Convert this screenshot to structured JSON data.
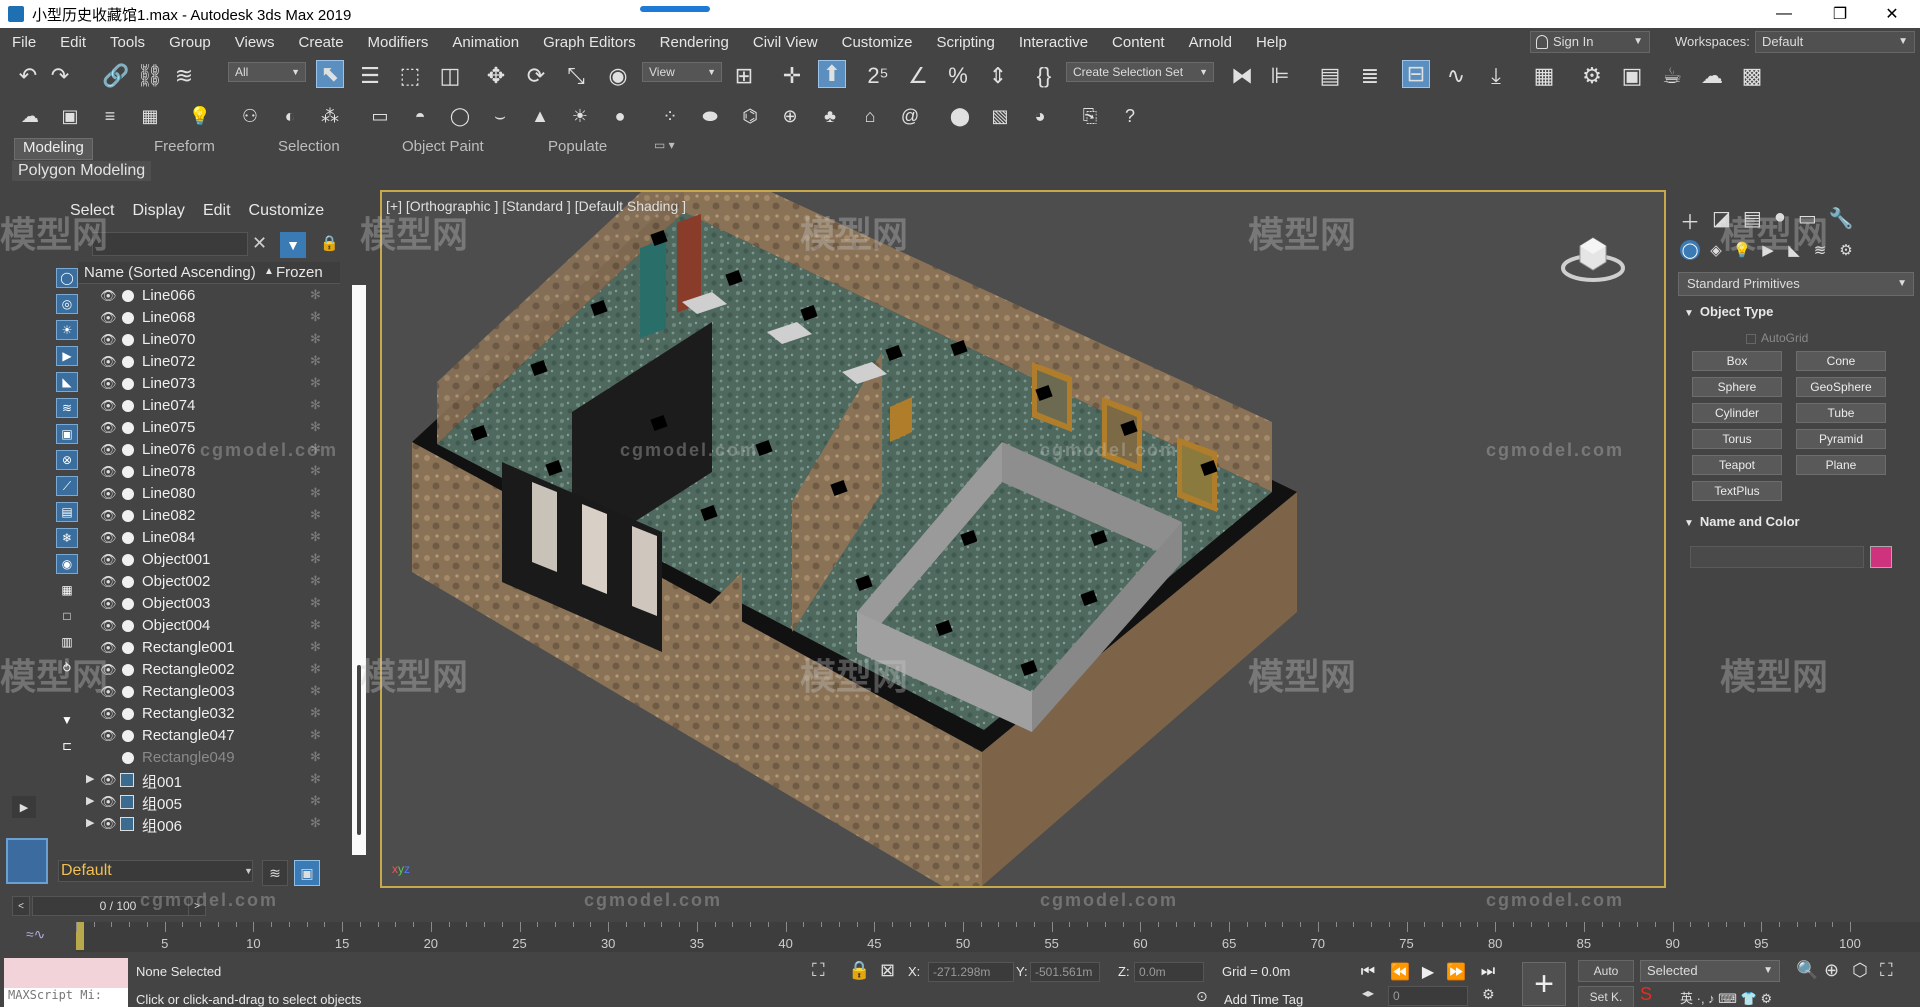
{
  "window": {
    "title": "小型历史收藏馆1.max - Autodesk 3ds Max 2019",
    "controls": [
      "—",
      "❐",
      "✕"
    ]
  },
  "menu": [
    "File",
    "Edit",
    "Tools",
    "Group",
    "Views",
    "Create",
    "Modifiers",
    "Animation",
    "Graph Editors",
    "Rendering",
    "Civil View",
    "Customize",
    "Scripting",
    "Interactive",
    "Content",
    "Arnold",
    "Help"
  ],
  "account": {
    "signin_label": "Sign In",
    "workspaces_label": "Workspaces:",
    "workspace_value": "Default"
  },
  "toolbar": {
    "filter_value": "All",
    "refcoord_value": "View",
    "selection_set_placeholder": "Create Selection Set"
  },
  "ribbon": {
    "tabs": [
      "Modeling",
      "Freeform",
      "Selection",
      "Object Paint",
      "Populate"
    ],
    "active_tab": "Modeling",
    "subpanel": "Polygon Modeling"
  },
  "explorer": {
    "tabs": [
      "Select",
      "Display",
      "Edit",
      "Customize"
    ],
    "col_name": "Name (Sorted Ascending)",
    "col_frozen": "Frozen",
    "rows": [
      {
        "name": "Line066",
        "type": "obj"
      },
      {
        "name": "Line068",
        "type": "obj"
      },
      {
        "name": "Line070",
        "type": "obj"
      },
      {
        "name": "Line072",
        "type": "obj"
      },
      {
        "name": "Line073",
        "type": "obj"
      },
      {
        "name": "Line074",
        "type": "obj"
      },
      {
        "name": "Line075",
        "type": "obj"
      },
      {
        "name": "Line076",
        "type": "obj"
      },
      {
        "name": "Line078",
        "type": "obj"
      },
      {
        "name": "Line080",
        "type": "obj"
      },
      {
        "name": "Line082",
        "type": "obj"
      },
      {
        "name": "Line084",
        "type": "obj"
      },
      {
        "name": "Object001",
        "type": "obj"
      },
      {
        "name": "Object002",
        "type": "obj"
      },
      {
        "name": "Object003",
        "type": "obj"
      },
      {
        "name": "Object004",
        "type": "obj"
      },
      {
        "name": "Rectangle001",
        "type": "obj"
      },
      {
        "name": "Rectangle002",
        "type": "obj"
      },
      {
        "name": "Rectangle003",
        "type": "obj"
      },
      {
        "name": "Rectangle032",
        "type": "obj"
      },
      {
        "name": "Rectangle047",
        "type": "obj"
      },
      {
        "name": "Rectangle049",
        "type": "dim"
      },
      {
        "name": "组001",
        "type": "grp"
      },
      {
        "name": "组005",
        "type": "grp"
      },
      {
        "name": "组006",
        "type": "grp"
      }
    ],
    "layer_value": "Default"
  },
  "viewport": {
    "label": "[+] [Orthographic ] [Standard ] [Default Shading ]"
  },
  "command_panel": {
    "category": "Standard Primitives",
    "object_type_header": "Object Type",
    "autogrid_label": "AutoGrid",
    "primitives": [
      "Box",
      "Cone",
      "Sphere",
      "GeoSphere",
      "Cylinder",
      "Tube",
      "Torus",
      "Pyramid",
      "Teapot",
      "Plane",
      "TextPlus"
    ],
    "name_color_header": "Name and Color",
    "color_hex": "#d0337e"
  },
  "timeline": {
    "frame_display": "0 / 100",
    "ticks": [
      "5",
      "10",
      "15",
      "20",
      "25",
      "30",
      "35",
      "40",
      "45",
      "50",
      "55",
      "60",
      "65",
      "70",
      "75",
      "80",
      "85",
      "90",
      "95",
      "100"
    ]
  },
  "status": {
    "maxscript_placeholder": "MAXScript Mi:",
    "selection_text": "None Selected",
    "prompt_text": "Click or click-and-drag to select objects",
    "x_label": "X:",
    "x_value": "-271.298m",
    "y_label": "Y:",
    "y_value": "-501.561m",
    "z_label": "Z:",
    "z_value": "0.0m",
    "grid_text": "Grid = 0.0m",
    "add_time_tag": "Add Time Tag",
    "auto_label": "Auto",
    "setkey_label": "Set K.",
    "selected_value": "Selected",
    "frame_field": "0"
  },
  "watermark": {
    "text": "模型网",
    "url_text": "cgmodel.com"
  }
}
